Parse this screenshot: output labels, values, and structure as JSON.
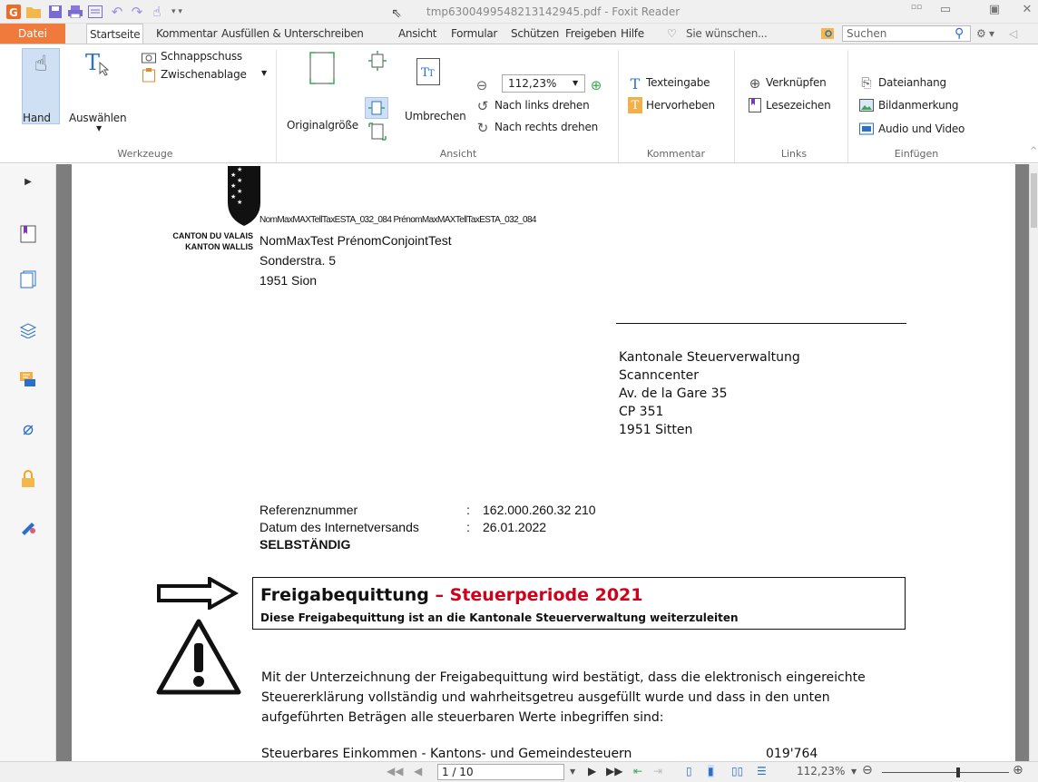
{
  "window": {
    "title": "tmp6300499548213142945.pdf - Foxit Reader"
  },
  "menu": {
    "file": "Datei",
    "tabs": [
      "Startseite",
      "Kommentar",
      "Ausfüllen & Unterschreiben",
      "Ansicht",
      "Formular",
      "Schützen",
      "Freigeben",
      "Hilfe"
    ],
    "tell_me": "Sie wünschen...",
    "search_placeholder": "Suchen"
  },
  "ribbon": {
    "hand": "Hand",
    "select": "Auswählen",
    "snapshot": "Schnappschuss",
    "clipboard": "Zwischenablage",
    "group_tools": "Werkzeuge",
    "actual_size": "Originalgröße",
    "reflow": "Umbrechen",
    "zoom_value": "112,23%",
    "rotate_left": "Nach links drehen",
    "rotate_right": "Nach rechts drehen",
    "group_view": "Ansicht",
    "typewriter": "Texteingabe",
    "highlight": "Hervorheben",
    "group_comment": "Kommentar",
    "link": "Verknüpfen",
    "bookmark": "Lesezeichen",
    "group_links": "Links",
    "file_attachment": "Dateianhang",
    "image_annotation": "Bildanmerkung",
    "audio_video": "Audio und Video",
    "group_insert": "Einfügen"
  },
  "document": {
    "canton_fr": "CANTON DU VALAIS",
    "canton_de": "KANTON WALLIS",
    "sender_line": "NomMaxMAXTellTaxESTA_032_084 PrénomMaxMAXTellTaxESTA_032_084",
    "recipient_name": "NomMaxTest PrénomConjointTest",
    "street": "Sonderstra. 5",
    "city": "1951 Sion",
    "addr_1": "Kantonale Steuerverwaltung",
    "addr_2": "Scanncenter",
    "addr_3": "Av. de la Gare 35",
    "addr_4": "CP 351",
    "addr_5": "1951 Sitten",
    "ref_label": "Referenznummer",
    "ref_colon": ":",
    "ref_value": "162.000.260.32  210",
    "date_label": "Datum des Internetversands",
    "date_colon": ":",
    "date_value": "26.01.2022",
    "status": "SELBSTÄNDIG",
    "box_title_a": "Freigabequittung",
    "box_title_b": " – Steuerperiode ",
    "box_year": "2021",
    "box_sub": "Diese Freigabequittung ist an die Kantonale Steuerverwaltung weiterzuleiten",
    "para_1": "Mit der Unterzeichnung der Freigabequittung wird bestätigt, dass die elektronisch eingereichte",
    "para_2": "Steuererklärung vollständig und wahrheitsgetreu ausgefüllt wurde und dass in den unten",
    "para_3": "aufgeführten Beträgen alle steuerbaren Werte inbegriffen sind:",
    "cut_line": "Steuerbares Einkommen - Kantons- und Gemeindesteuern",
    "cut_value": "019'764"
  },
  "status": {
    "page": "1 / 10",
    "zoom": "112,23%"
  },
  "colors": {
    "accent": "#ef7a3b",
    "red_text": "#d0021b"
  }
}
